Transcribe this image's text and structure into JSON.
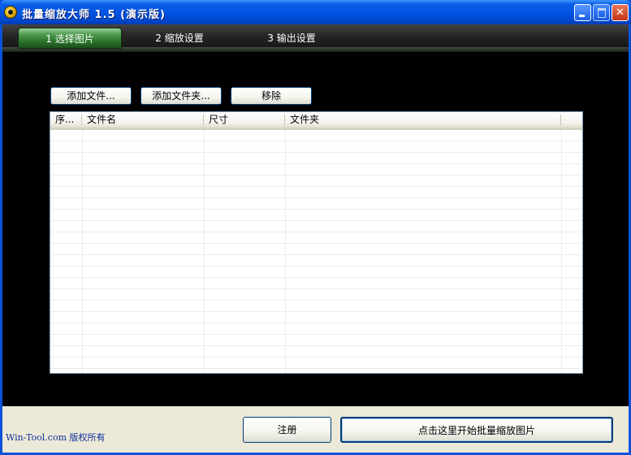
{
  "window": {
    "title": "批量缩放大师 1.5 (演示版)",
    "controls": {
      "minimize": "_",
      "maximize": "□",
      "close": "✕"
    }
  },
  "tabs": [
    {
      "label": "1 选择图片",
      "active": true
    },
    {
      "label": "2 缩放设置",
      "active": false
    },
    {
      "label": "3 输出设置",
      "active": false
    }
  ],
  "toolbar": {
    "add_file": "添加文件...",
    "add_folder": "添加文件夹...",
    "remove": "移除"
  },
  "file_list": {
    "columns": [
      "序...",
      "文件名",
      "尺寸",
      "文件夹"
    ],
    "rows": []
  },
  "footer": {
    "copyright": "Win-Tool.com 版权所有",
    "register": "注册",
    "start": "点击这里开始批量缩放图片"
  },
  "colors": {
    "titlebar": "#0054e3",
    "active_tab": "#2f7a2f",
    "panel_bg": "#000000",
    "statusbar_bg": "#ece9d8",
    "copyright_text": "#0c2e9c"
  }
}
